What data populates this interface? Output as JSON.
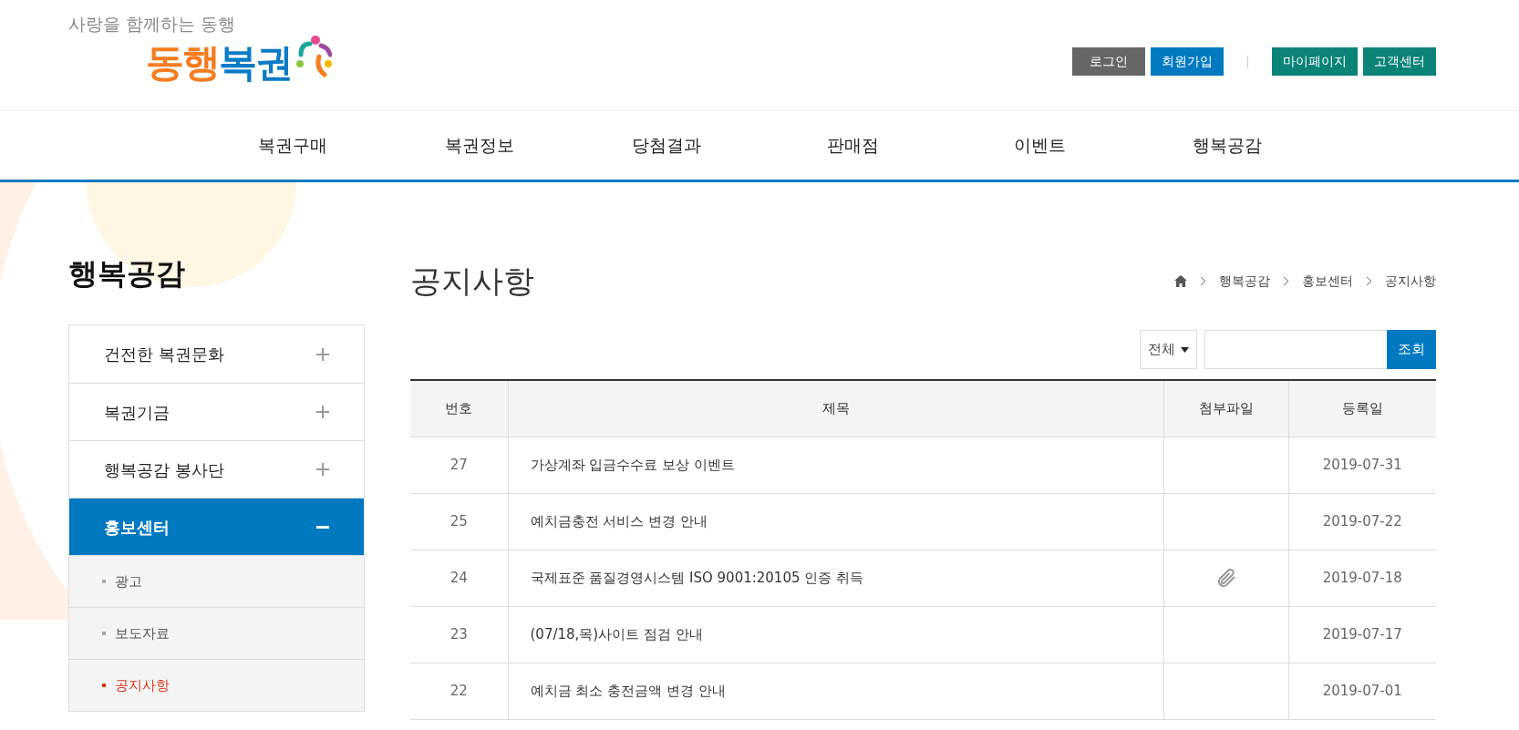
{
  "logo": {
    "tagline": "사랑을 함께하는 동행",
    "name_part_1": "동행",
    "name_part_2": "복권"
  },
  "header_buttons": [
    {
      "label": "로그인",
      "color": "#666666"
    },
    {
      "label": "회원가입",
      "color": "#0079c1"
    },
    {
      "label": "마이페이지",
      "color": "#0b8377"
    },
    {
      "label": "고객센터",
      "color": "#0b8377"
    }
  ],
  "nav": [
    "복권구매",
    "복권정보",
    "당첨결과",
    "판매점",
    "이벤트",
    "행복공감"
  ],
  "sidebar": {
    "title": "행복공감",
    "items": [
      {
        "label": "건전한 복권문화",
        "expanded": false
      },
      {
        "label": "복권기금",
        "expanded": false
      },
      {
        "label": "행복공감 봉사단",
        "expanded": false
      },
      {
        "label": "홍보센터",
        "expanded": true,
        "children": [
          {
            "label": "광고",
            "selected": false
          },
          {
            "label": "보도자료",
            "selected": false
          },
          {
            "label": "공지사항",
            "selected": true
          }
        ]
      }
    ]
  },
  "page_title": "공지사항",
  "breadcrumb": [
    "행복공감",
    "홍보센터",
    "공지사항"
  ],
  "search": {
    "filter": "전체",
    "button": "조회"
  },
  "table": {
    "columns": [
      "번호",
      "제목",
      "첨부파일",
      "등록일"
    ],
    "rows": [
      {
        "number": "27",
        "title": "가상계좌 입금수수료 보상 이벤트",
        "has_attachment": false,
        "date": "2019-07-31"
      },
      {
        "number": "25",
        "title": "예치금충전 서비스 변경 안내",
        "has_attachment": false,
        "date": "2019-07-22"
      },
      {
        "number": "24",
        "title": "국제표준 품질경영시스템 ISO 9001:20105 인증 취득",
        "has_attachment": true,
        "date": "2019-07-18"
      },
      {
        "number": "23",
        "title": "(07/18,목)사이트 점검 안내",
        "has_attachment": false,
        "date": "2019-07-17"
      },
      {
        "number": "22",
        "title": "예치금 최소 충전금액 변경 안내",
        "has_attachment": false,
        "date": "2019-07-01"
      }
    ]
  }
}
